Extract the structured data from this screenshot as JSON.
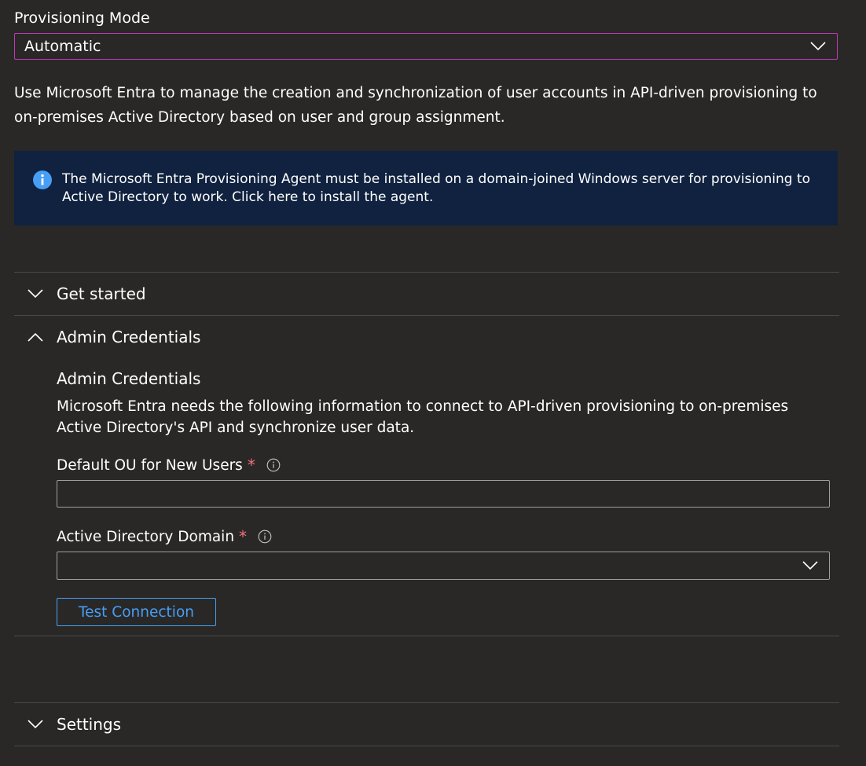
{
  "provisioning_mode": {
    "label": "Provisioning Mode",
    "selected": "Automatic"
  },
  "description": "Use Microsoft Entra to manage the creation and synchronization of user accounts in API-driven provisioning to on-premises Active Directory based on user and group assignment.",
  "info_banner": {
    "text": "The Microsoft Entra Provisioning Agent must be installed on a domain-joined Windows server for provisioning to Active Directory to work. Click here to install the agent.",
    "icon": "info-icon",
    "icon_color": "#479ef5"
  },
  "sections": {
    "get_started": {
      "label": "Get started",
      "expanded": false
    },
    "admin_credentials": {
      "label": "Admin Credentials",
      "expanded": true,
      "title": "Admin Credentials",
      "description": "Microsoft Entra needs the following information to connect to API-driven provisioning to on-premises Active Directory's API and synchronize user data.",
      "fields": {
        "default_ou": {
          "label": "Default OU for New Users",
          "required_mark": "*",
          "value": ""
        },
        "ad_domain": {
          "label": "Active Directory Domain",
          "required_mark": "*",
          "selected": ""
        }
      },
      "test_button": "Test Connection"
    },
    "settings": {
      "label": "Settings",
      "expanded": false
    }
  },
  "colors": {
    "background": "#292827",
    "accent_focus": "#c239b3",
    "link_blue": "#479ef5",
    "required_red": "#f1707b",
    "banner_bg": "#10223f"
  }
}
